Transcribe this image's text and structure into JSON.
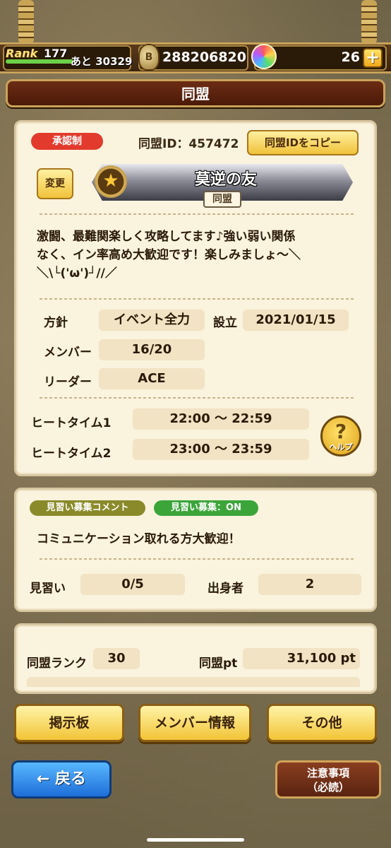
{
  "header": {
    "rank_label": "Rank",
    "rank_value": "177",
    "rank_next": "あと 30329",
    "coin_icon": "money-bag-icon",
    "coins": "288206820",
    "gem_icon": "rainbow-gem-icon",
    "gems": "26",
    "plus_label": "+"
  },
  "title": "同盟",
  "guild": {
    "approval_badge": "承認制",
    "id_label": "同盟ID：457472",
    "copy_button": "同盟IDをコピー",
    "change_button": "変更",
    "emblem_icon": "star-emblem-icon",
    "emblem_glyph": "★",
    "name": "莫逆の友",
    "name_sub": "同盟",
    "description": "激闘、最難関楽しく攻略してます♪強い弱い関係\nなく、イン率高め大歓迎です！楽しみましょ〜＼\n＼\\└('ω')┘//／",
    "policy_label": "方針",
    "policy_value": "イベント全力",
    "founded_label": "設立",
    "founded_value": "2021/01/15",
    "members_label": "メンバー",
    "members_value": "16/20",
    "leader_label": "リーダー",
    "leader_value": "ACE",
    "heat1_label": "ヒートタイム1",
    "heat1_value": "22:00 ～ 22:59",
    "heat2_label": "ヒートタイム2",
    "heat2_value": "23:00 ～ 23:59",
    "help_glyph": "?",
    "help_label": "ヘルプ"
  },
  "recruit": {
    "comment_badge": "見習い募集コメント",
    "status_badge": "見習い募集：ON",
    "comment": "コミュニケーション取れる方大歓迎！",
    "apprentice_label": "見習い",
    "apprentice_value": "0/5",
    "origin_label": "出身者",
    "origin_value": "2"
  },
  "stats": {
    "rank_label": "同盟ランク",
    "rank_value": "30",
    "pt_label": "同盟pt",
    "pt_value": "31,100 pt"
  },
  "nav": {
    "board": "掲示板",
    "member_info": "メンバー情報",
    "other": "その他",
    "back": "← 戻る",
    "notice": "注意事項\n（必読）"
  }
}
